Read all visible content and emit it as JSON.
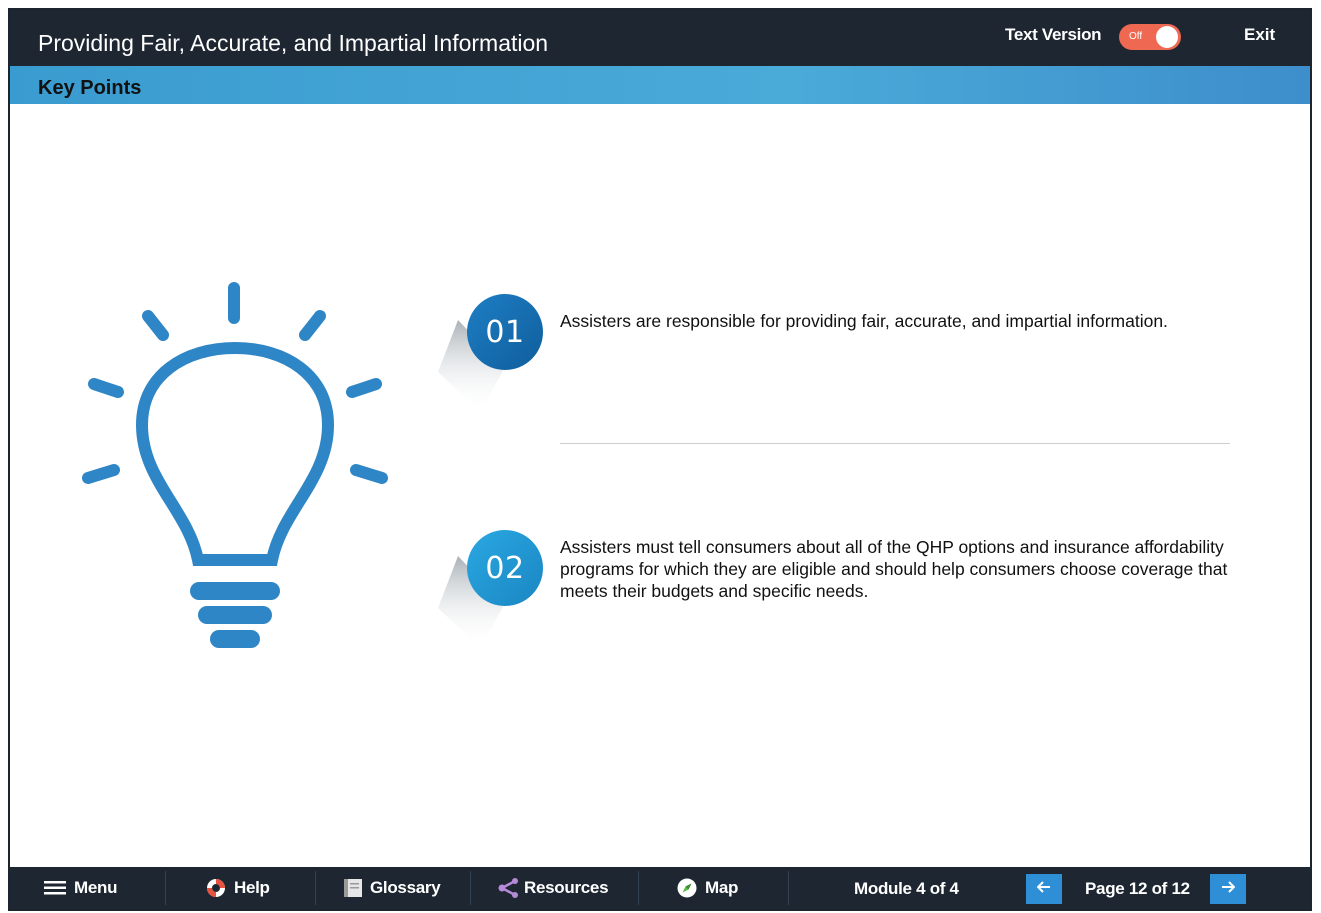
{
  "header": {
    "title": "Providing Fair, Accurate, and Impartial Information",
    "text_version_label": "Text Version",
    "toggle_state": "Off",
    "exit_label": "Exit"
  },
  "section": {
    "title": "Key Points"
  },
  "key_points": [
    {
      "number": "01",
      "text": "Assisters are responsible for providing fair, accurate, and impartial information."
    },
    {
      "number": "02",
      "text": "Assisters must tell consumers about all of the QHP options and insurance affordability programs for which they are eligible and should help consumers choose coverage that meets their budgets and specific needs."
    }
  ],
  "footer": {
    "menu": {
      "label": "Menu",
      "icon": "hamburger-icon"
    },
    "help": {
      "label": "Help",
      "icon": "lifebuoy-icon"
    },
    "glossary": {
      "label": "Glossary",
      "icon": "book-icon"
    },
    "resources": {
      "label": "Resources",
      "icon": "share-icon"
    },
    "map": {
      "label": "Map",
      "icon": "compass-icon"
    },
    "module": "Module 4 of 4",
    "page": "Page 12 of 12"
  },
  "colors": {
    "header_bg": "#1d2631",
    "accent_blue": "#3a9bd0",
    "bulb_blue": "#2f86c6",
    "toggle_off": "#ee6852",
    "nav_button": "#2f8fd6"
  }
}
